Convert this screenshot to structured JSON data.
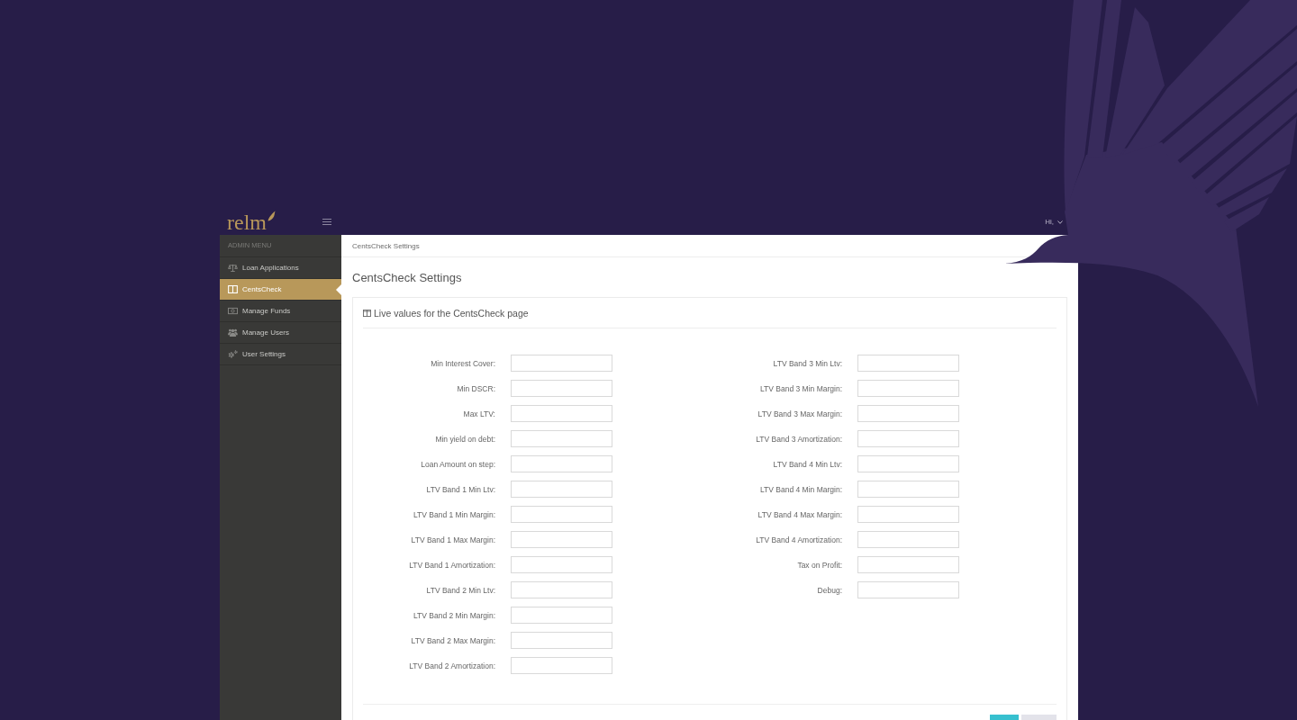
{
  "header": {
    "logo": "relm",
    "greeting": "Hi,"
  },
  "sidebar": {
    "heading": "ADMIN MENU",
    "items": [
      {
        "label": "Loan Applications",
        "selected": false
      },
      {
        "label": "CentsCheck",
        "selected": true
      },
      {
        "label": "Manage Funds",
        "selected": false
      },
      {
        "label": "Manage Users",
        "selected": false
      },
      {
        "label": "User Settings",
        "selected": false
      }
    ]
  },
  "breadcrumb": "CentsCheck Settings",
  "page_title": "CentsCheck Settings",
  "panel": {
    "title": "Live values for the CentsCheck page",
    "columns": [
      {
        "fields": [
          {
            "label": "Min Interest Cover:"
          },
          {
            "label": "Min DSCR:"
          },
          {
            "label": "Max LTV:"
          },
          {
            "label": "Min yield on debt:"
          },
          {
            "label": "Loan Amount on step:"
          },
          {
            "label": "LTV Band 1 Min Ltv:"
          },
          {
            "label": "LTV Band 1 Min Margin:"
          },
          {
            "label": "LTV Band 1 Max Margin:"
          },
          {
            "label": "LTV Band 1 Amortization:"
          },
          {
            "label": "LTV Band 2 Min Ltv:"
          },
          {
            "label": "LTV Band 2 Min Margin:"
          },
          {
            "label": "LTV Band 2 Max Margin:"
          },
          {
            "label": "LTV Band 2 Amortization:"
          }
        ]
      },
      {
        "fields": [
          {
            "label": "LTV Band 3 Min Ltv:"
          },
          {
            "label": "LTV Band 3 Min Margin:"
          },
          {
            "label": "LTV Band 3 Max Margin:"
          },
          {
            "label": "LTV Band 3 Amortization:"
          },
          {
            "label": "LTV Band 4 Min Ltv:"
          },
          {
            "label": "LTV Band 4 Min Margin:"
          },
          {
            "label": "LTV Band 4 Max Margin:"
          },
          {
            "label": "LTV Band 4 Amortization:"
          },
          {
            "label": "Tax on Profit:"
          },
          {
            "label": "Debug:"
          }
        ]
      }
    ],
    "buttons": [
      {
        "kind": "primary"
      },
      {
        "kind": "default"
      }
    ]
  }
}
